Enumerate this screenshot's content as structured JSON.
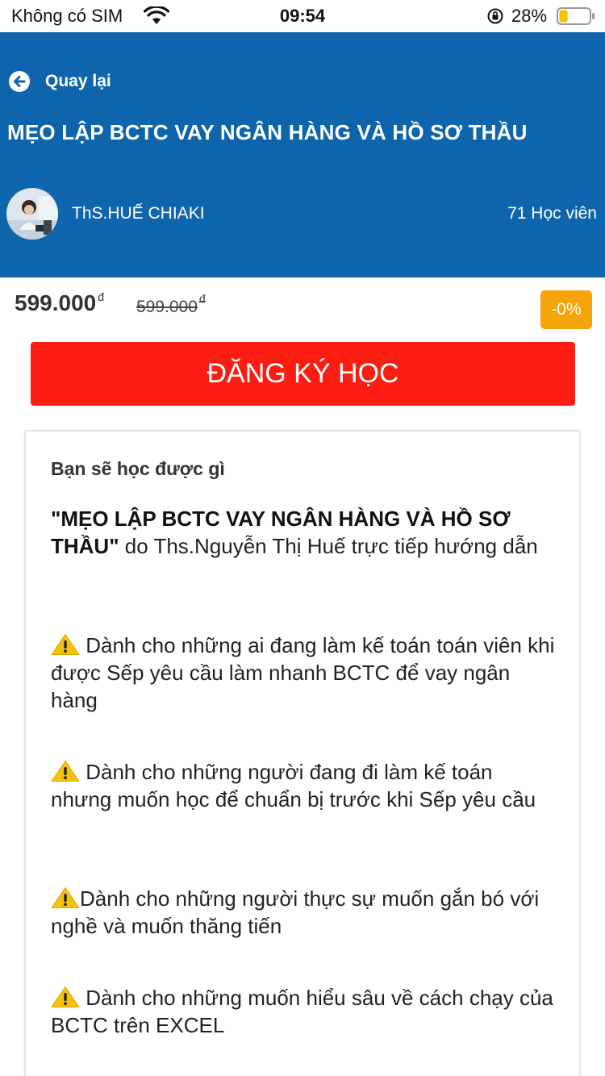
{
  "status_bar": {
    "carrier": "Không có SIM",
    "time": "09:54",
    "battery_percent": "28%",
    "battery_level": 0.28,
    "icons": [
      "wifi-icon",
      "orientation-lock-icon",
      "battery-icon"
    ]
  },
  "header": {
    "back_label": "Quay lại",
    "course_title": "MẸO LẬP BCTC VAY NGÂN HÀNG VÀ HỒ SƠ THẦU",
    "teacher_name": "ThS.HUẾ CHIAKI",
    "students": "71 Học viên",
    "background_color": "#0f65ab"
  },
  "pricing": {
    "price": "599.000",
    "old_price": "599.000",
    "currency": "đ",
    "discount": "-0%",
    "discount_color": "#f5a40a"
  },
  "register_button": {
    "label": "ĐĂNG KÝ HỌC",
    "color": "#fb1d12"
  },
  "content": {
    "heading": "Bạn sẽ học được gì",
    "intro_bold": "\"MẸO LẬP BCTC VAY NGÂN HÀNG VÀ HỒ SƠ THẦU\"",
    "intro_rest": " do Ths.Nguyễn Thị Huế trực tiếp hướng dẫn",
    "bullets": [
      {
        "icon": "warning-icon",
        "text": " Dành cho những ai đang làm kế toán toán viên khi được Sếp yêu cầu làm nhanh BCTC để vay ngân hàng"
      },
      {
        "icon": "warning-icon",
        "text": " Dành cho những người đang đi làm kế toán nhưng muốn học để chuẩn bị trước khi Sếp yêu cầu"
      },
      {
        "icon": "warning-icon",
        "text": "Dành cho những người thực sự muốn gắn bó với nghề và muốn thăng tiến"
      },
      {
        "icon": "warning-icon",
        "text": "  Dành cho những muốn hiểu sâu về cách chạy của BCTC trên EXCEL"
      }
    ]
  }
}
